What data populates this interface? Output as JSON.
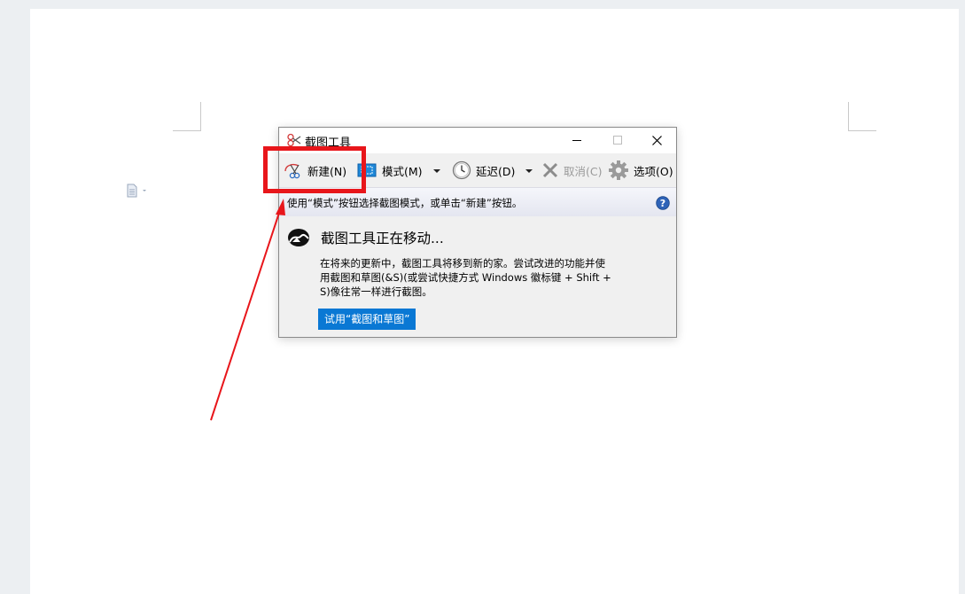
{
  "dialog": {
    "title": "截图工具",
    "toolbar": {
      "new_label": "新建(N)",
      "mode_label": "模式(M)",
      "delay_label": "延迟(D)",
      "cancel_label": "取消(C)",
      "options_label": "选项(O)"
    },
    "info_text": "使用“模式”按钮选择截图模式，或单击“新建”按钮。",
    "heading": "截图工具正在移动...",
    "paragraph_lines": [
      "在将来的更新中，截图工具将移到新的家。尝试改进的功能并使",
      "用截图和草图(&S)(或尝试快捷方式 Windows 徽标键 + Shift +",
      "S)像往常一样进行截图。"
    ],
    "try_button_label": "试用“截图和草图”"
  },
  "colors": {
    "highlight": "#e8161b",
    "accent": "#0a78d4"
  },
  "icons": [
    "document-icon",
    "scissors-icon",
    "mode-icon",
    "clock-icon",
    "close-x-icon",
    "gear-icon",
    "help-icon",
    "snip-sketch-icon"
  ]
}
